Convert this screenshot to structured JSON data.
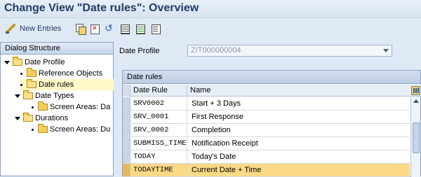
{
  "window": {
    "title": "Change View \"Date rules\": Overview"
  },
  "toolbar": {
    "new_entries_label": "New Entries",
    "icons": [
      "pencil-icon",
      "copy-icon",
      "delete-icon",
      "undo-icon",
      "select-all-icon",
      "select-block-icon",
      "deselect-all-icon"
    ]
  },
  "dialog_structure": {
    "header": "Dialog Structure",
    "items": [
      {
        "label": "Date Profile",
        "level": 0,
        "expanded": true
      },
      {
        "label": "Reference Objects",
        "level": 1
      },
      {
        "label": "Date rules",
        "level": 1,
        "selected": true
      },
      {
        "label": "Date Types",
        "level": 1,
        "expanded": true
      },
      {
        "label": "Screen Areas: Da",
        "level": 2
      },
      {
        "label": "Durations",
        "level": 1,
        "expanded": true
      },
      {
        "label": "Screen Areas: Du",
        "level": 2
      }
    ]
  },
  "main": {
    "date_profile_label": "Date Profile",
    "date_profile_value": "ZIT000000004",
    "table": {
      "title": "Date rules",
      "columns": [
        "Date Rule",
        "Name"
      ],
      "rows": [
        {
          "rule": "SRV0002",
          "name": "Start + 3 Days"
        },
        {
          "rule": "SRV_0001",
          "name": "First Response"
        },
        {
          "rule": "SRV_0002",
          "name": "Completion"
        },
        {
          "rule": "SUBMISS_TIME",
          "name": "Notification Receipt"
        },
        {
          "rule": "TODAY",
          "name": "Today's Date"
        },
        {
          "rule": "TODAYTIME",
          "name": "Current Date + Time",
          "highlighted": true
        }
      ]
    }
  },
  "colors": {
    "title_text": "#1f3d66",
    "highlight_row": "#fbd987",
    "selected_tree_item": "#fff8c8",
    "folder": "#f4cf5a"
  }
}
